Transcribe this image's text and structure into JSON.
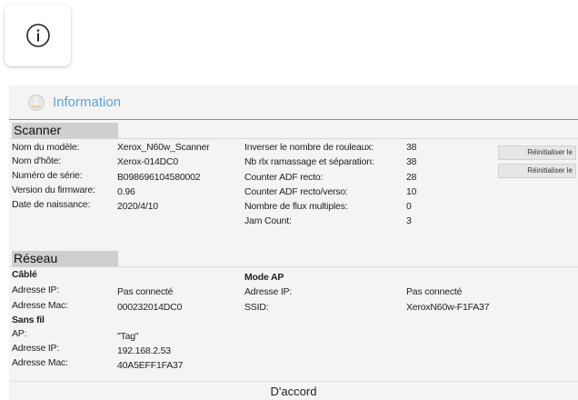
{
  "dialog": {
    "title": "Information",
    "ok_label": "D'accord"
  },
  "scanner": {
    "section_label": "Scanner",
    "fields": [
      {
        "label": "Nom du modèle:",
        "value": "Xerox_N60w_Scanner"
      },
      {
        "label": "Nom d'hôte:",
        "value": "Xerox-014DC0"
      },
      {
        "label": "Numéro de série:",
        "value": "B098696104580002"
      },
      {
        "label": "Version du firmware:",
        "value": "0.96"
      },
      {
        "label": "Date de naissance:",
        "value": "2020/4/10"
      }
    ],
    "counters": [
      {
        "label": "Inverser le nombre de rouleaux:",
        "value": "38"
      },
      {
        "label": "Nb rlx ramassage et séparation:",
        "value": "38"
      },
      {
        "label": "Counter ADF recto:",
        "value": "28"
      },
      {
        "label": "Counter ADF recto/verso:",
        "value": "10"
      },
      {
        "label": "Nombre de flux multiples:",
        "value": "0"
      },
      {
        "label": "Jam Count:",
        "value": "3"
      }
    ],
    "reset_buttons": [
      "Réinitialiser le",
      "Réinitialiser le"
    ]
  },
  "network": {
    "section_label": "Réseau",
    "wired": {
      "heading": "Câblé",
      "fields": [
        {
          "label": "Adresse IP:",
          "value": "Pas connecté"
        },
        {
          "label": "Adresse Mac:",
          "value": "000232014DC0"
        }
      ]
    },
    "wireless": {
      "heading": "Sans fil",
      "fields": [
        {
          "label": "AP:",
          "value": "\"Tag\""
        },
        {
          "label": "Adresse IP:",
          "value": "192.168.2.53"
        },
        {
          "label": "Adresse Mac:",
          "value": "40A5EFF1FA37"
        }
      ]
    },
    "ap_mode": {
      "heading": "Mode AP",
      "fields": [
        {
          "label": "Adresse IP:",
          "value": "Pas connecté"
        },
        {
          "label": "SSID:",
          "value": "XeroxN60w-F1FA37"
        }
      ]
    }
  },
  "colors": {
    "accent": "#5aa3dc",
    "header_line": "#4da3e0",
    "section_bg": "#cfcfcf",
    "dialog_bg": "#f4f4f4"
  },
  "icons": {
    "top_tile": "info-icon",
    "header": "info-icon"
  }
}
